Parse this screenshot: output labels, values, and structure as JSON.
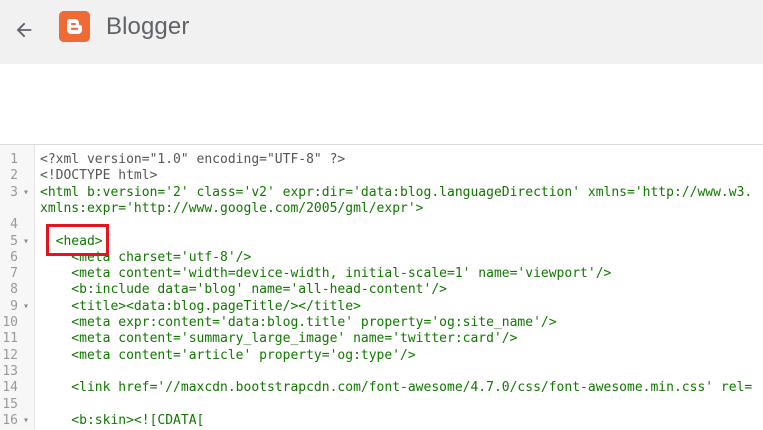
{
  "header": {
    "title": "Blogger",
    "back_icon": "arrow-left-icon",
    "logo_icon": "blogger-logo-icon",
    "colors": {
      "bar": "#f1f1f1",
      "logo": "#f06a35",
      "title": "#5f6368"
    }
  },
  "editor": {
    "colors": {
      "tag": "#117700",
      "annotation_box": "#e3141e"
    },
    "annotated_line": 5,
    "lines": [
      {
        "num": "1",
        "fold": "",
        "text": "<?xml version=\"1.0\" encoding=\"UTF-8\" ?>"
      },
      {
        "num": "2",
        "fold": "",
        "text": "<!DOCTYPE html>"
      },
      {
        "num": "3",
        "fold": "▾",
        "text": "<html b:version='2' class='v2' expr:dir='data:blog.languageDirection' xmlns='http://www.w3."
      },
      {
        "num": "",
        "fold": "",
        "text": "xmlns:expr='http://www.google.com/2005/gml/expr'>"
      },
      {
        "num": "4",
        "fold": "",
        "text": ""
      },
      {
        "num": "5",
        "fold": "▾",
        "text": "  <head>"
      },
      {
        "num": "6",
        "fold": "",
        "text": "    <meta charset='utf-8'/>"
      },
      {
        "num": "7",
        "fold": "",
        "text": "    <meta content='width=device-width, initial-scale=1' name='viewport'/>"
      },
      {
        "num": "8",
        "fold": "",
        "text": "    <b:include data='blog' name='all-head-content'/>"
      },
      {
        "num": "9",
        "fold": "▾",
        "text": "    <title><data:blog.pageTitle/></title>"
      },
      {
        "num": "10",
        "fold": "",
        "text": "    <meta expr:content='data:blog.title' property='og:site_name'/>"
      },
      {
        "num": "11",
        "fold": "",
        "text": "    <meta content='summary_large_image' name='twitter:card'/>"
      },
      {
        "num": "12",
        "fold": "",
        "text": "    <meta content='article' property='og:type'/>"
      },
      {
        "num": "13",
        "fold": "",
        "text": ""
      },
      {
        "num": "14",
        "fold": "",
        "text": "    <link href='//maxcdn.bootstrapcdn.com/font-awesome/4.7.0/css/font-awesome.min.css' rel="
      },
      {
        "num": "15",
        "fold": "",
        "text": ""
      },
      {
        "num": "16",
        "fold": "▾",
        "text": "    <b:skin><![CDATA["
      },
      {
        "num": "",
        "fold": "",
        "text": "/*"
      }
    ]
  }
}
